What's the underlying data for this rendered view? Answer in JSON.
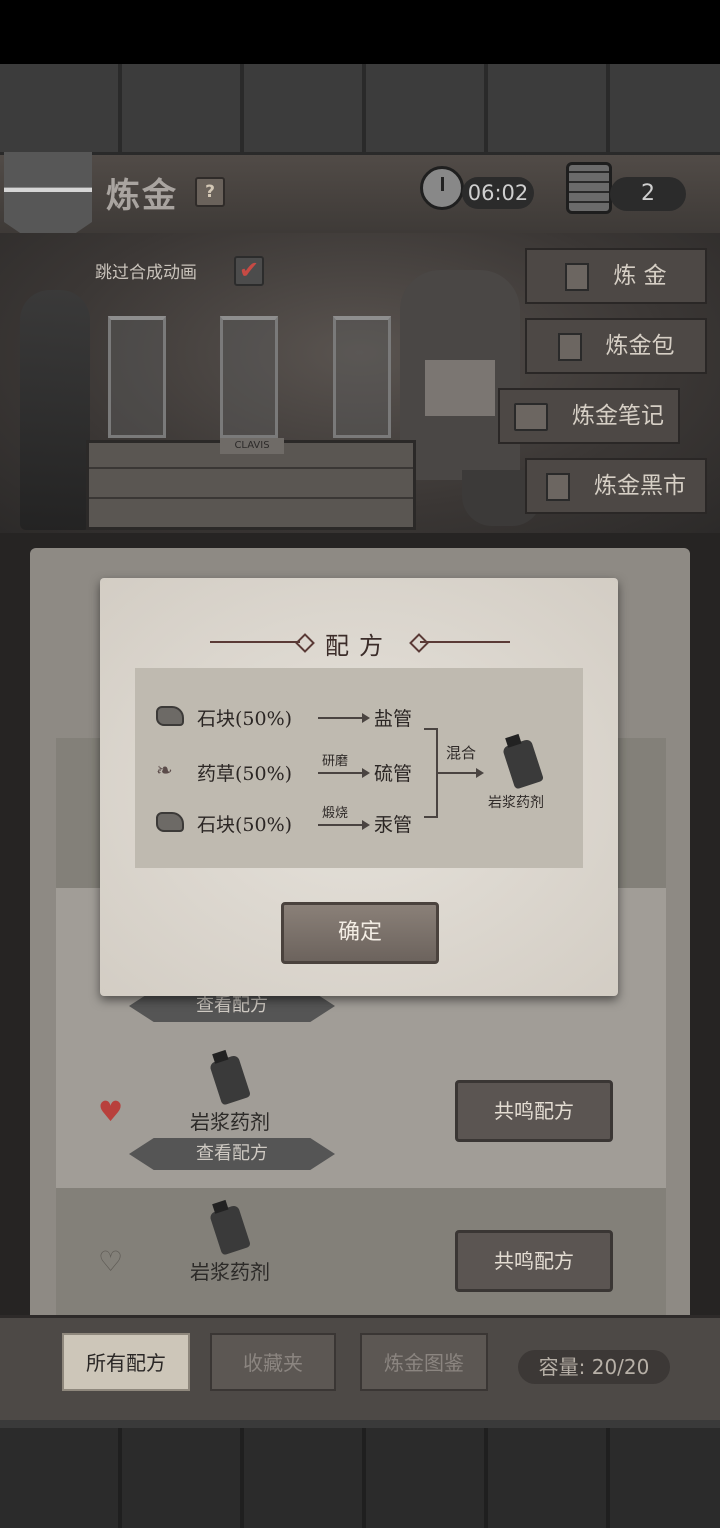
{
  "header": {
    "back_icon": "left-arrow-icon",
    "title": "炼金",
    "help": "?",
    "timer": "06:02",
    "calendar_value": "2"
  },
  "scene": {
    "skip_animation_label": "跳过合成动画",
    "skip_checked": true,
    "crate_label": "CLAVIS"
  },
  "side_menu": [
    "炼 金",
    "炼金包",
    "炼金笔记",
    "炼金黑市"
  ],
  "list": {
    "items": [
      {
        "name": "岩浆药剂",
        "view": "查看配方",
        "resonate": "共鸣配方",
        "favorite": true
      },
      {
        "name": "岩浆药剂",
        "view": "查看配方",
        "resonate": "共鸣配方",
        "favorite": false
      }
    ],
    "partial_view_label": "查看配方"
  },
  "tabs": {
    "all": "所有配方",
    "favorites": "收藏夹",
    "atlas": "炼金图鉴",
    "capacity": "容量: 20/20"
  },
  "dialog": {
    "title": "配方",
    "ingredients": [
      {
        "icon": "stone-icon",
        "text": "石块(50%)",
        "process": "",
        "tube": "盐管"
      },
      {
        "icon": "herb-icon",
        "text": "药草(50%)",
        "process": "研磨",
        "tube": "硫管"
      },
      {
        "icon": "stone-icon",
        "text": "石块(50%)",
        "process": "煅烧",
        "tube": "汞管"
      }
    ],
    "combine": "混合",
    "result": "岩浆药剂",
    "confirm": "确定"
  }
}
